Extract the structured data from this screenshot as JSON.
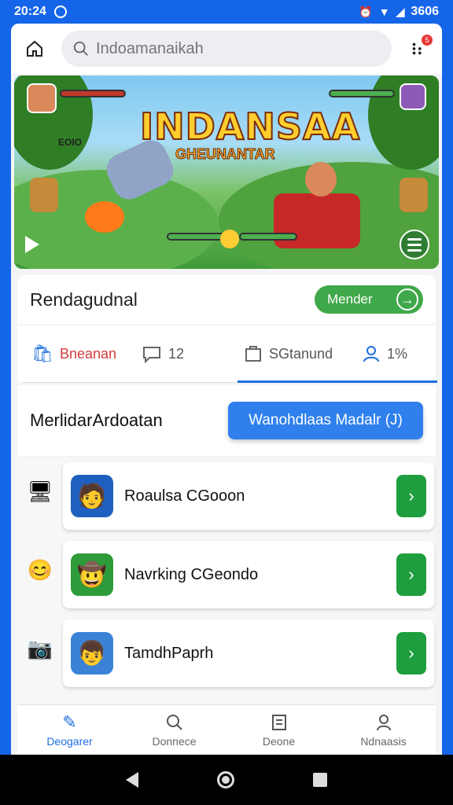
{
  "status_bar": {
    "time": "20:24",
    "signal_text": "3606"
  },
  "search": {
    "placeholder": "Indoamanaikah",
    "notif_count": "5"
  },
  "banner": {
    "title": "INDANSAA",
    "subtitle": "GHEUNANTAR",
    "hud_text": "EOIO"
  },
  "card": {
    "title": "Rendagudnal",
    "button_label": "Mender"
  },
  "tabs": [
    {
      "label": "Bneanan",
      "icon": "bag-icon"
    },
    {
      "label": "12",
      "icon": "chat-icon"
    },
    {
      "label": "SGtanund",
      "icon": "store-icon"
    },
    {
      "label": "1%",
      "icon": "user-icon"
    }
  ],
  "section": {
    "title": "MerlidarArdoatan",
    "button_label": "Wanohdlaas Madalr (J)"
  },
  "list_items": [
    {
      "name": "Roaulsa CGooon",
      "side_icon": "monitor-icon",
      "avatar_icon": "character-icon",
      "avatar_color": "#1f5fbf"
    },
    {
      "name": "Navrking CGeondo",
      "side_icon": "smile-icon",
      "avatar_icon": "explorer-icon",
      "avatar_color": "#2e9b3a"
    },
    {
      "name": "TamdhPaprh",
      "side_icon": "camera-icon",
      "avatar_icon": "hero-icon",
      "avatar_color": "#3b82d6"
    }
  ],
  "bottom_nav": [
    {
      "label": "Deogarer",
      "icon": "edit-icon",
      "active": true
    },
    {
      "label": "Donnece",
      "icon": "search-icon",
      "active": false
    },
    {
      "label": "Deone",
      "icon": "doc-icon",
      "active": false
    },
    {
      "label": "Ndnaasis",
      "icon": "person-icon",
      "active": false
    }
  ],
  "colors": {
    "accent_blue": "#1e6fe0",
    "green": "#3fa84a",
    "status_blue": "#1565e8"
  }
}
